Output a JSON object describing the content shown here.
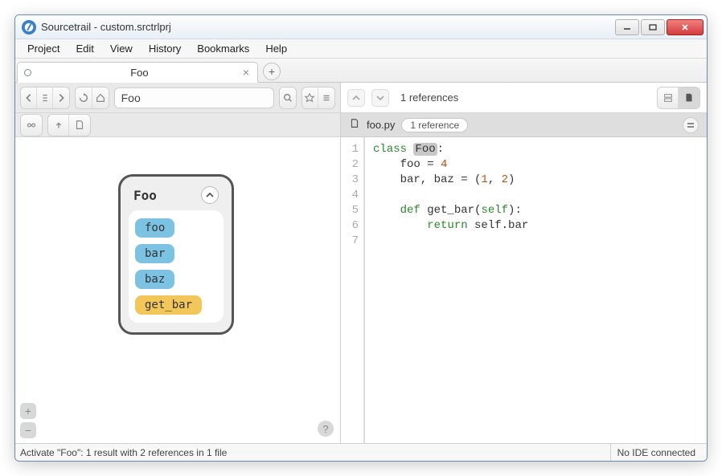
{
  "window": {
    "title": "Sourcetrail - custom.srctrlprj"
  },
  "menubar": {
    "items": [
      "Project",
      "Edit",
      "View",
      "History",
      "Bookmarks",
      "Help"
    ]
  },
  "tab": {
    "label": "Foo"
  },
  "search": {
    "value": "Foo"
  },
  "graph": {
    "node_name": "Foo",
    "members": [
      {
        "name": "foo",
        "kind": "var"
      },
      {
        "name": "bar",
        "kind": "var"
      },
      {
        "name": "baz",
        "kind": "var"
      },
      {
        "name": "get_bar",
        "kind": "func"
      }
    ]
  },
  "refs": {
    "summary": "1 references",
    "file": "foo.py",
    "file_badge": "1 reference"
  },
  "code": {
    "lines": [
      [
        {
          "t": "class ",
          "c": "kw"
        },
        {
          "t": "Foo",
          "c": "hi"
        },
        {
          "t": ":",
          "c": ""
        }
      ],
      [
        {
          "t": "    foo = ",
          "c": ""
        },
        {
          "t": "4",
          "c": "num"
        }
      ],
      [
        {
          "t": "    bar, baz = (",
          "c": ""
        },
        {
          "t": "1",
          "c": "num"
        },
        {
          "t": ", ",
          "c": ""
        },
        {
          "t": "2",
          "c": "num"
        },
        {
          "t": ")",
          "c": ""
        }
      ],
      [],
      [
        {
          "t": "    ",
          "c": ""
        },
        {
          "t": "def ",
          "c": "kw"
        },
        {
          "t": "get_bar(",
          "c": ""
        },
        {
          "t": "self",
          "c": "kw"
        },
        {
          "t": "):",
          "c": ""
        }
      ],
      [
        {
          "t": "        ",
          "c": ""
        },
        {
          "t": "return ",
          "c": "kw"
        },
        {
          "t": "self.bar",
          "c": ""
        }
      ],
      []
    ]
  },
  "status": {
    "left": "Activate \"Foo\": 1 result with 2 references in 1 file",
    "right": "No IDE connected"
  }
}
